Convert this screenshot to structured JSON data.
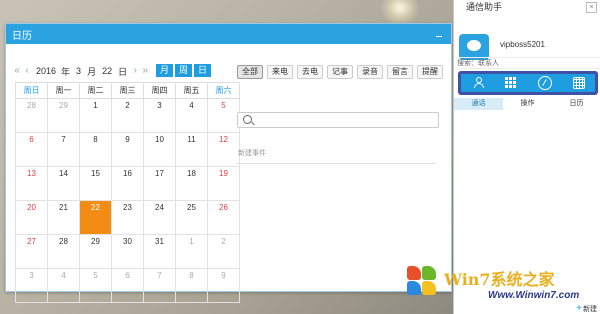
{
  "calendar": {
    "title": "日历",
    "year": "2016",
    "year_unit": "年",
    "month": "3",
    "month_unit": "月",
    "day": "22",
    "day_unit": "日",
    "views": [
      "月",
      "周",
      "日"
    ],
    "weekdays": [
      "周日",
      "周一",
      "周二",
      "周三",
      "周四",
      "周五",
      "周六"
    ],
    "weeks": [
      [
        "28",
        "29",
        "1",
        "2",
        "3",
        "4",
        "5"
      ],
      [
        "6",
        "7",
        "8",
        "9",
        "10",
        "11",
        "12"
      ],
      [
        "13",
        "14",
        "15",
        "16",
        "17",
        "18",
        "19"
      ],
      [
        "20",
        "21",
        "22",
        "23",
        "24",
        "25",
        "26"
      ],
      [
        "27",
        "28",
        "29",
        "30",
        "31",
        "1",
        "2"
      ],
      [
        "3",
        "4",
        "5",
        "6",
        "7",
        "8",
        "9"
      ]
    ],
    "filters": [
      "全部",
      "来电",
      "去电",
      "记事",
      "录音",
      "留言",
      "提醒"
    ],
    "new_event": "新建事件"
  },
  "assistant": {
    "title": "通信助手",
    "username": "vipboss5201",
    "search_label": "搜索：联系人",
    "toolbar_icons": [
      "contacts-icon",
      "apps-grid-icon",
      "compass-icon",
      "calendar-icon"
    ],
    "tabs": [
      "通话",
      "操作",
      "日历"
    ],
    "new_label": "新建"
  },
  "watermark": {
    "brand": "Win7系统之家",
    "url": "Www.Winwin7.com"
  },
  "colors": {
    "accent": "#2aa3e0",
    "selected_day": "#f28c14",
    "weekend": "#e04040",
    "toolbar_border": "#3f52a6"
  }
}
